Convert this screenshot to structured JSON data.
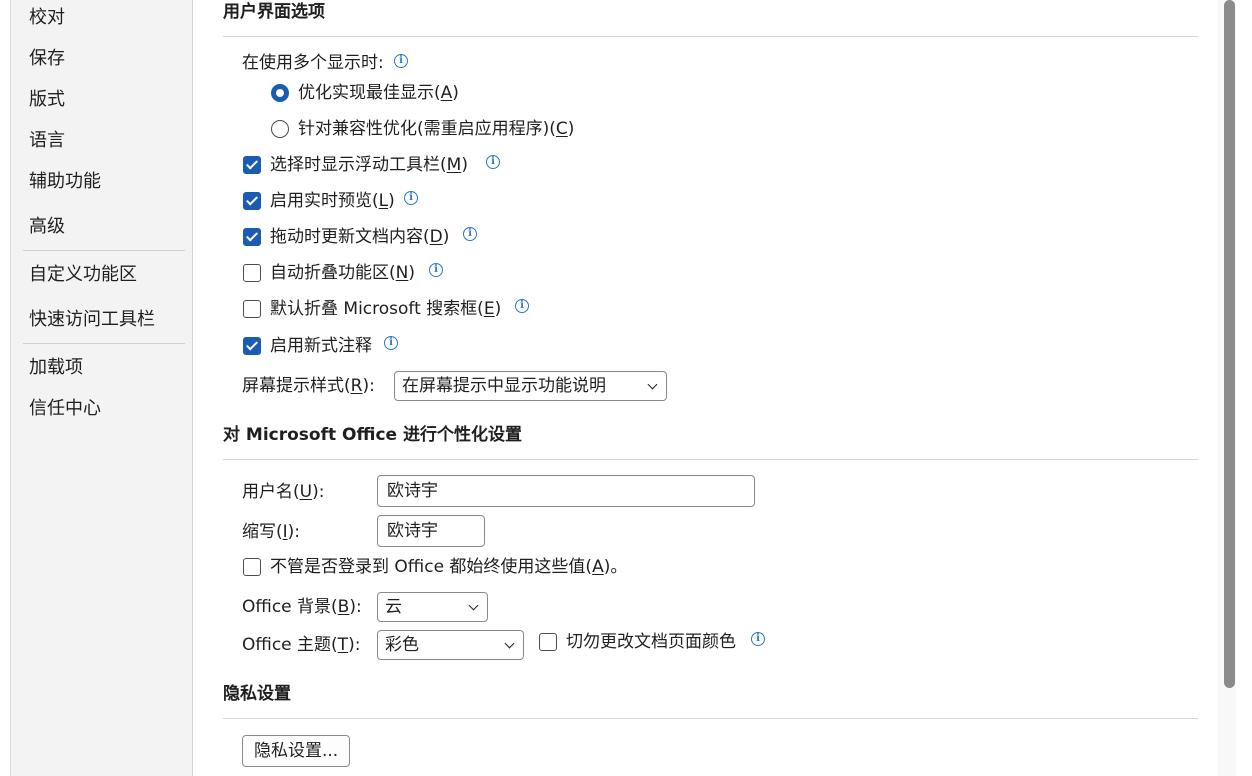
{
  "sidebar": {
    "items": [
      {
        "label": "校对"
      },
      {
        "label": "保存"
      },
      {
        "label": "版式"
      },
      {
        "label": "语言"
      },
      {
        "label": "辅助功能"
      },
      {
        "label": "高级"
      },
      {
        "label": "自定义功能区"
      },
      {
        "label": "快速访问工具栏"
      },
      {
        "label": "加载项"
      },
      {
        "label": "信任中心"
      }
    ]
  },
  "ui_options": {
    "title": "用户界面选项",
    "multi_display": {
      "label": "在使用多个显示时:",
      "options": [
        {
          "pre": "优化实现最佳显示(",
          "key": "A",
          "post": ")",
          "selected": true
        },
        {
          "pre": "针对兼容性优化(需重启应用程序)(",
          "key": "C",
          "post": ")",
          "selected": false
        }
      ]
    },
    "checkboxes": [
      {
        "pre": "选择时显示浮动工具栏(",
        "key": "M",
        "post": ")",
        "checked": true
      },
      {
        "pre": "启用实时预览(",
        "key": "L",
        "post": ")",
        "checked": true
      },
      {
        "pre": "拖动时更新文档内容(",
        "key": "D",
        "post": ")",
        "checked": true
      },
      {
        "pre": "自动折叠功能区(",
        "key": "N",
        "post": ")",
        "checked": false
      },
      {
        "pre": "默认折叠 Microsoft 搜索框(",
        "key": "E",
        "post": ")",
        "checked": false
      },
      {
        "pre": "启用新式注释",
        "key": "",
        "post": "",
        "checked": true
      }
    ],
    "screentip": {
      "pre": "屏幕提示样式(",
      "key": "R",
      "post": "):",
      "value": "在屏幕提示中显示功能说明"
    }
  },
  "personalize": {
    "title": "对 Microsoft Office 进行个性化设置",
    "username": {
      "pre": "用户名(",
      "key": "U",
      "post": "):",
      "value": "欧诗宇"
    },
    "initials": {
      "pre": "缩写(",
      "key": "I",
      "post": "):",
      "value": "欧诗宇"
    },
    "always_use": {
      "pre": "不管是否登录到 Office 都始终使用这些值(",
      "key": "A",
      "post": ")。",
      "checked": false
    },
    "background": {
      "pre": "Office 背景(",
      "key": "B",
      "post": "):",
      "value": "云"
    },
    "theme": {
      "pre": "Office 主题(",
      "key": "T",
      "post": "):",
      "value": "彩色"
    },
    "never_change": {
      "label": "切勿更改文档页面颜色",
      "checked": false
    }
  },
  "privacy": {
    "title": "隐私设置",
    "button_label": "隐私设置..."
  },
  "colors": {
    "accent": "#1b5bb4",
    "info_icon": "#2b78c2"
  },
  "icons": {
    "info": "info-circle-icon",
    "dropdown": "chevron-down-icon"
  }
}
